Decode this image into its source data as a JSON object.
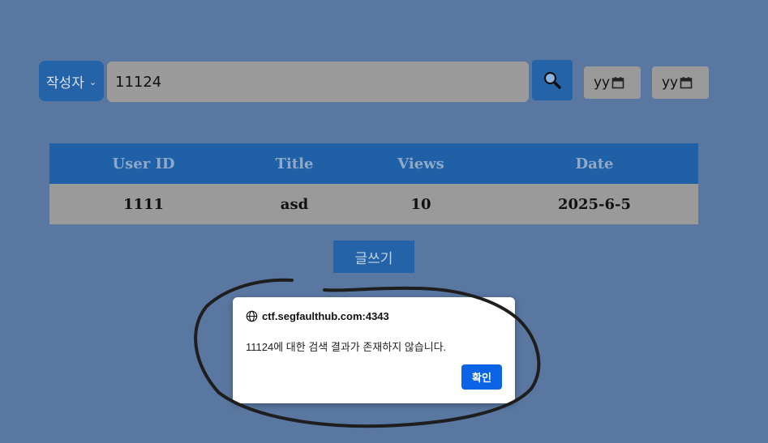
{
  "search": {
    "filter_label": "작성자",
    "query": "11124",
    "date_from_text": "yyyy",
    "date_to_text": "yyyy"
  },
  "table": {
    "headers": [
      "User ID",
      "Title",
      "Views",
      "Date"
    ],
    "rows": [
      [
        "1111",
        "asd",
        "10",
        "2025-6-5"
      ]
    ]
  },
  "write_button": {
    "label": "글쓰기"
  },
  "dialog": {
    "origin": "ctf.segfaulthub.com:4343",
    "message": "11124에 대한 검색 결과가 존재하지 않습니다.",
    "ok_label": "확인"
  },
  "colors": {
    "background": "#5977a0",
    "accent": "#2563a8",
    "dialog_button": "#0b63e6"
  }
}
